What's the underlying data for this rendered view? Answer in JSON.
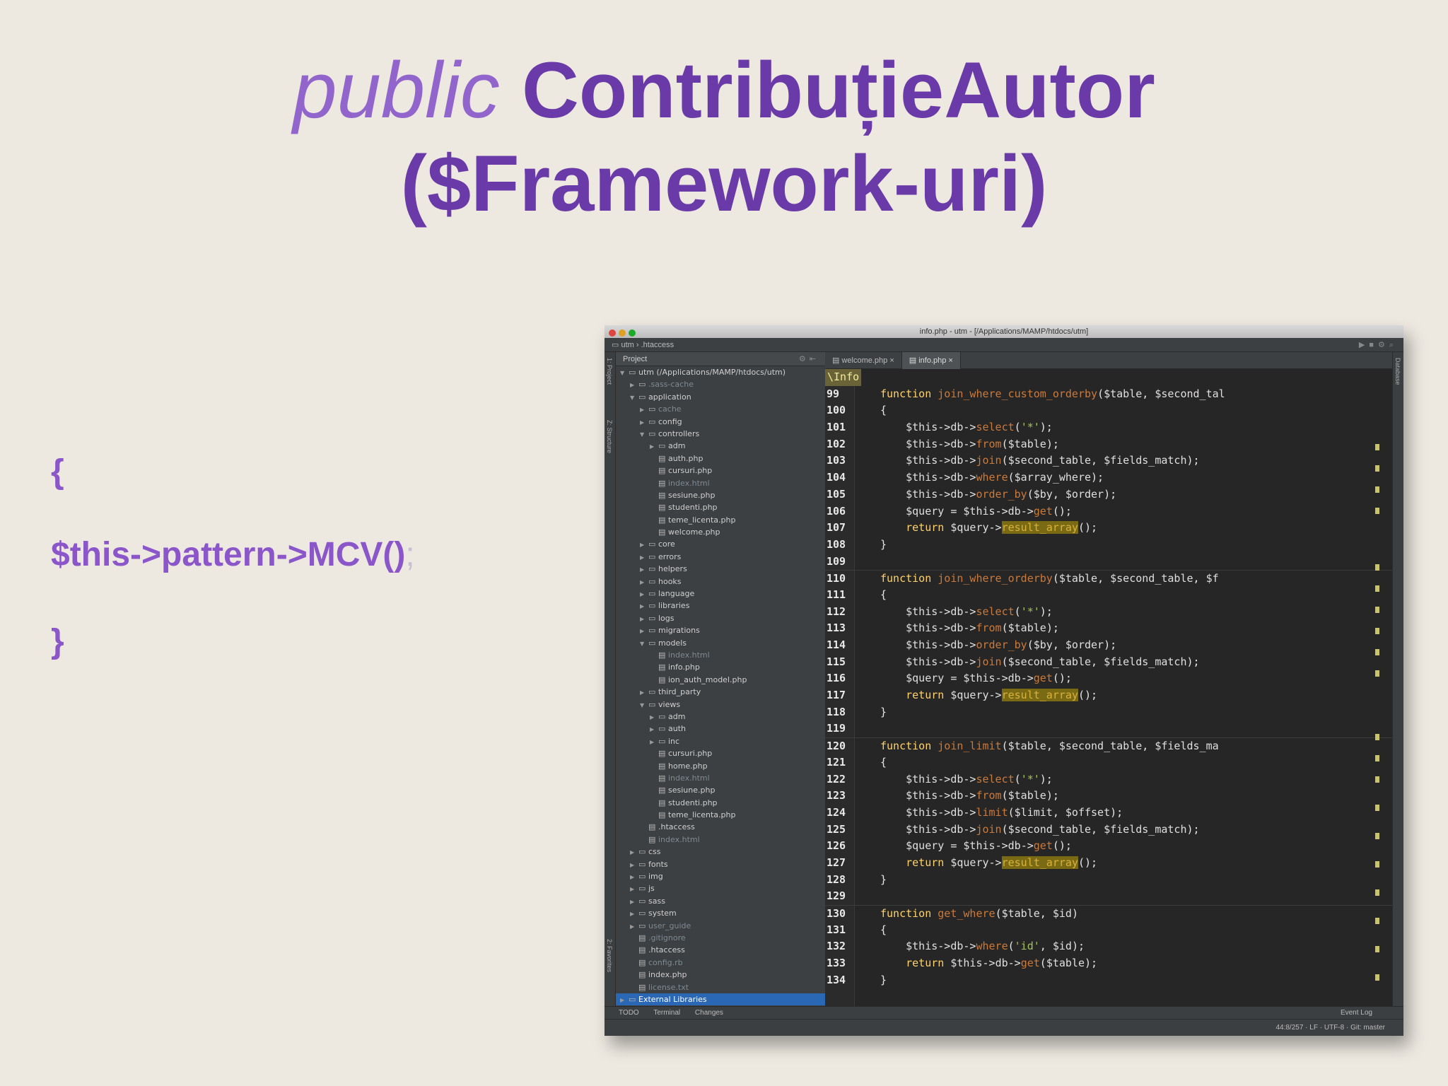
{
  "slide": {
    "title_keyword": "public",
    "title_name": "ContribuțieAutor",
    "title_line2": "($Framework-uri)",
    "code_open": "{",
    "code_statement": "$this->pattern->MCV()",
    "code_semicolon": ";",
    "code_close": "}"
  },
  "ide": {
    "window_title": "info.php - utm - [/Applications/MAMP/htdocs/utm]",
    "nav": {
      "project": "utm",
      "file": ".htaccess"
    },
    "left_strip": {
      "project": "1: Project",
      "structure": "Z: Structure",
      "favorites": "2: Favorites"
    },
    "right_strip": {
      "database": "Database"
    },
    "project_panel": {
      "label": "Project"
    },
    "tree": [
      {
        "d": 0,
        "t": "f",
        "o": true,
        "n": "utm  (/Applications/MAMP/htdocs/utm)"
      },
      {
        "d": 1,
        "t": "f",
        "o": false,
        "n": ".sass-cache",
        "dim": true
      },
      {
        "d": 1,
        "t": "f",
        "o": true,
        "n": "application"
      },
      {
        "d": 2,
        "t": "f",
        "o": false,
        "n": "cache",
        "dim": true
      },
      {
        "d": 2,
        "t": "f",
        "o": false,
        "n": "config"
      },
      {
        "d": 2,
        "t": "f",
        "o": true,
        "n": "controllers"
      },
      {
        "d": 3,
        "t": "f",
        "o": false,
        "n": "adm"
      },
      {
        "d": 3,
        "t": "p",
        "n": "auth.php"
      },
      {
        "d": 3,
        "t": "p",
        "n": "cursuri.php"
      },
      {
        "d": 3,
        "t": "p",
        "n": "index.html",
        "dim": true
      },
      {
        "d": 3,
        "t": "p",
        "n": "sesiune.php"
      },
      {
        "d": 3,
        "t": "p",
        "n": "studenti.php"
      },
      {
        "d": 3,
        "t": "p",
        "n": "teme_licenta.php"
      },
      {
        "d": 3,
        "t": "p",
        "n": "welcome.php"
      },
      {
        "d": 2,
        "t": "f",
        "o": false,
        "n": "core"
      },
      {
        "d": 2,
        "t": "f",
        "o": false,
        "n": "errors"
      },
      {
        "d": 2,
        "t": "f",
        "o": false,
        "n": "helpers"
      },
      {
        "d": 2,
        "t": "f",
        "o": false,
        "n": "hooks"
      },
      {
        "d": 2,
        "t": "f",
        "o": false,
        "n": "language"
      },
      {
        "d": 2,
        "t": "f",
        "o": false,
        "n": "libraries"
      },
      {
        "d": 2,
        "t": "f",
        "o": false,
        "n": "logs"
      },
      {
        "d": 2,
        "t": "f",
        "o": false,
        "n": "migrations"
      },
      {
        "d": 2,
        "t": "f",
        "o": true,
        "n": "models"
      },
      {
        "d": 3,
        "t": "p",
        "n": "index.html",
        "dim": true
      },
      {
        "d": 3,
        "t": "p",
        "n": "info.php"
      },
      {
        "d": 3,
        "t": "p",
        "n": "ion_auth_model.php"
      },
      {
        "d": 2,
        "t": "f",
        "o": false,
        "n": "third_party"
      },
      {
        "d": 2,
        "t": "f",
        "o": true,
        "n": "views"
      },
      {
        "d": 3,
        "t": "f",
        "o": false,
        "n": "adm"
      },
      {
        "d": 3,
        "t": "f",
        "o": false,
        "n": "auth"
      },
      {
        "d": 3,
        "t": "f",
        "o": false,
        "n": "inc"
      },
      {
        "d": 3,
        "t": "p",
        "n": "cursuri.php"
      },
      {
        "d": 3,
        "t": "p",
        "n": "home.php"
      },
      {
        "d": 3,
        "t": "p",
        "n": "index.html",
        "dim": true
      },
      {
        "d": 3,
        "t": "p",
        "n": "sesiune.php"
      },
      {
        "d": 3,
        "t": "p",
        "n": "studenti.php"
      },
      {
        "d": 3,
        "t": "p",
        "n": "teme_licenta.php"
      },
      {
        "d": 2,
        "t": "p",
        "n": ".htaccess"
      },
      {
        "d": 2,
        "t": "p",
        "n": "index.html",
        "dim": true
      },
      {
        "d": 1,
        "t": "f",
        "o": false,
        "n": "css"
      },
      {
        "d": 1,
        "t": "f",
        "o": false,
        "n": "fonts"
      },
      {
        "d": 1,
        "t": "f",
        "o": false,
        "n": "img"
      },
      {
        "d": 1,
        "t": "f",
        "o": false,
        "n": "js"
      },
      {
        "d": 1,
        "t": "f",
        "o": false,
        "n": "sass"
      },
      {
        "d": 1,
        "t": "f",
        "o": false,
        "n": "system"
      },
      {
        "d": 1,
        "t": "f",
        "o": false,
        "n": "user_guide",
        "dim": true
      },
      {
        "d": 1,
        "t": "p",
        "n": ".gitignore",
        "dim": true
      },
      {
        "d": 1,
        "t": "p",
        "n": ".htaccess"
      },
      {
        "d": 1,
        "t": "p",
        "n": "config.rb",
        "dim": true
      },
      {
        "d": 1,
        "t": "p",
        "n": "index.php"
      },
      {
        "d": 1,
        "t": "p",
        "n": "license.txt",
        "dim": true
      },
      {
        "d": 0,
        "t": "f",
        "o": false,
        "n": "External Libraries",
        "sel": true
      }
    ],
    "tabs": [
      {
        "label": "welcome.php",
        "active": false
      },
      {
        "label": "info.php",
        "active": true
      }
    ],
    "info_tag": "\\Info",
    "code": [
      {
        "n": "99",
        "h": "<span class=\"k\">function</span> <span class=\"f\">join_where_custom_orderby</span>(<span class=\"v\">$table</span>, <span class=\"v\">$second_tal</span>",
        "sep": false
      },
      {
        "n": "100",
        "h": "{"
      },
      {
        "n": "101",
        "h": "    <span class=\"v\">$this</span>-&gt;<span class=\"v\">db</span>-&gt;<span class=\"f\">select</span>(<span class=\"s\">'*'</span>);"
      },
      {
        "n": "102",
        "h": "    <span class=\"v\">$this</span>-&gt;<span class=\"v\">db</span>-&gt;<span class=\"f\">from</span>(<span class=\"v\">$table</span>);"
      },
      {
        "n": "103",
        "h": "    <span class=\"v\">$this</span>-&gt;<span class=\"v\">db</span>-&gt;<span class=\"f\">join</span>(<span class=\"v\">$second_table</span>, <span class=\"v\">$fields_match</span>);"
      },
      {
        "n": "104",
        "h": "    <span class=\"v\">$this</span>-&gt;<span class=\"v\">db</span>-&gt;<span class=\"f\">where</span>(<span class=\"v\">$array_where</span>);"
      },
      {
        "n": "105",
        "h": "    <span class=\"v\">$this</span>-&gt;<span class=\"v\">db</span>-&gt;<span class=\"f\">order_by</span>(<span class=\"v\">$by</span>, <span class=\"v\">$order</span>);"
      },
      {
        "n": "106",
        "h": "    <span class=\"v\">$query</span> = <span class=\"v\">$this</span>-&gt;<span class=\"v\">db</span>-&gt;<span class=\"f\">get</span>();"
      },
      {
        "n": "107",
        "h": "    <span class=\"k\">return</span> <span class=\"v\">$query</span>-&gt;<span class=\"hl\">result_array</span>();"
      },
      {
        "n": "108",
        "h": "}"
      },
      {
        "n": "109",
        "h": ""
      },
      {
        "n": "110",
        "h": "<span class=\"k\">function</span> <span class=\"f\">join_where_orderby</span>(<span class=\"v\">$table</span>, <span class=\"v\">$second_table</span>, <span class=\"v\">$f</span>",
        "sep": true
      },
      {
        "n": "111",
        "h": "{"
      },
      {
        "n": "112",
        "h": "    <span class=\"v\">$this</span>-&gt;<span class=\"v\">db</span>-&gt;<span class=\"f\">select</span>(<span class=\"s\">'*'</span>);"
      },
      {
        "n": "113",
        "h": "    <span class=\"v\">$this</span>-&gt;<span class=\"v\">db</span>-&gt;<span class=\"f\">from</span>(<span class=\"v\">$table</span>);"
      },
      {
        "n": "114",
        "h": "    <span class=\"v\">$this</span>-&gt;<span class=\"v\">db</span>-&gt;<span class=\"f\">order_by</span>(<span class=\"v\">$by</span>, <span class=\"v\">$order</span>);"
      },
      {
        "n": "115",
        "h": "    <span class=\"v\">$this</span>-&gt;<span class=\"v\">db</span>-&gt;<span class=\"f\">join</span>(<span class=\"v\">$second_table</span>, <span class=\"v\">$fields_match</span>);"
      },
      {
        "n": "116",
        "h": "    <span class=\"v\">$query</span> = <span class=\"v\">$this</span>-&gt;<span class=\"v\">db</span>-&gt;<span class=\"f\">get</span>();"
      },
      {
        "n": "117",
        "h": "    <span class=\"k\">return</span> <span class=\"v\">$query</span>-&gt;<span class=\"hl\">result_array</span>();"
      },
      {
        "n": "118",
        "h": "}"
      },
      {
        "n": "119",
        "h": ""
      },
      {
        "n": "120",
        "h": "<span class=\"k\">function</span> <span class=\"f\">join_limit</span>(<span class=\"v\">$table</span>, <span class=\"v\">$second_table</span>, <span class=\"v\">$fields_ma</span>",
        "sep": true
      },
      {
        "n": "121",
        "h": "{"
      },
      {
        "n": "122",
        "h": "    <span class=\"v\">$this</span>-&gt;<span class=\"v\">db</span>-&gt;<span class=\"f\">select</span>(<span class=\"s\">'*'</span>);"
      },
      {
        "n": "123",
        "h": "    <span class=\"v\">$this</span>-&gt;<span class=\"v\">db</span>-&gt;<span class=\"f\">from</span>(<span class=\"v\">$table</span>);"
      },
      {
        "n": "124",
        "h": "    <span class=\"v\">$this</span>-&gt;<span class=\"v\">db</span>-&gt;<span class=\"f\">limit</span>(<span class=\"v\">$limit</span>, <span class=\"v\">$offset</span>);"
      },
      {
        "n": "125",
        "h": "    <span class=\"v\">$this</span>-&gt;<span class=\"v\">db</span>-&gt;<span class=\"f\">join</span>(<span class=\"v\">$second_table</span>, <span class=\"v\">$fields_match</span>);"
      },
      {
        "n": "126",
        "h": "    <span class=\"v\">$query</span> = <span class=\"v\">$this</span>-&gt;<span class=\"v\">db</span>-&gt;<span class=\"f\">get</span>();"
      },
      {
        "n": "127",
        "h": "    <span class=\"k\">return</span> <span class=\"v\">$query</span>-&gt;<span class=\"hl\">result_array</span>();"
      },
      {
        "n": "128",
        "h": "}"
      },
      {
        "n": "129",
        "h": ""
      },
      {
        "n": "130",
        "h": "<span class=\"k\">function</span> <span class=\"f\">get_where</span>(<span class=\"v\">$table</span>, <span class=\"v\">$id</span>)",
        "sep": true
      },
      {
        "n": "131",
        "h": "{"
      },
      {
        "n": "132",
        "h": "    <span class=\"v\">$this</span>-&gt;<span class=\"v\">db</span>-&gt;<span class=\"f\">where</span>(<span class=\"s\">'id'</span>, <span class=\"v\">$id</span>);"
      },
      {
        "n": "133",
        "h": "    <span class=\"k\">return</span> <span class=\"v\">$this</span>-&gt;<span class=\"v\">db</span>-&gt;<span class=\"f\">get</span>(<span class=\"v\">$table</span>);"
      },
      {
        "n": "134",
        "h": "}"
      }
    ],
    "bottom_bar": {
      "todo": "TODO",
      "terminal": "Terminal",
      "changes": "Changes",
      "event_log": "Event Log"
    },
    "status_bar": {
      "position": "44:8/257",
      "lf": "LF",
      "encoding": "UTF-8",
      "git": "Git: master"
    },
    "colors": {
      "title": "#6a3aa8",
      "keyword": "#9165cc",
      "code_text": "#8b56c9",
      "editor_bg": "#262626",
      "selection": "#2a67b5"
    }
  }
}
